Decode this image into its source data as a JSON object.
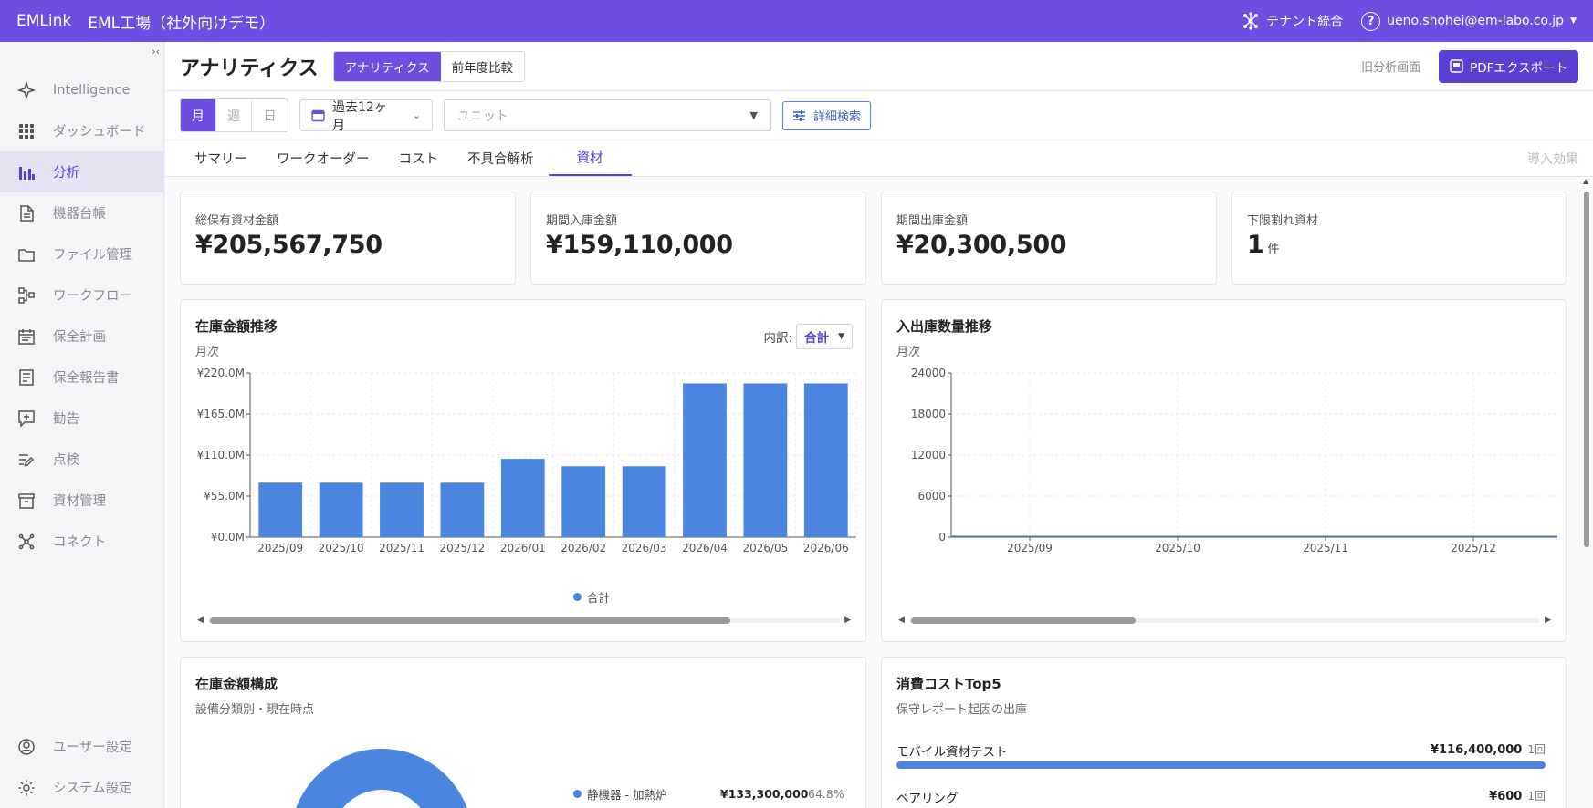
{
  "header": {
    "brand": "EMLink",
    "tenant": "EML工場（社外向けデモ）",
    "tenant_integration": "テナント統合",
    "user_email": "ueno.shohei@em-labo.co.jp"
  },
  "sidebar": {
    "collapse_glyph": "›‹",
    "items": [
      {
        "label": "Intelligence",
        "icon": "sparkle-icon"
      },
      {
        "label": "ダッシュボード",
        "icon": "grid-icon"
      },
      {
        "label": "分析",
        "icon": "bar-chart-icon",
        "active": true
      },
      {
        "label": "機器台帳",
        "icon": "document-icon"
      },
      {
        "label": "ファイル管理",
        "icon": "folder-icon"
      },
      {
        "label": "ワークフロー",
        "icon": "workflow-icon"
      },
      {
        "label": "保全計画",
        "icon": "calendar-icon"
      },
      {
        "label": "保全報告書",
        "icon": "report-icon"
      },
      {
        "label": "勧告",
        "icon": "advice-icon"
      },
      {
        "label": "点検",
        "icon": "inspection-icon"
      },
      {
        "label": "資材管理",
        "icon": "archive-icon"
      },
      {
        "label": "コネクト",
        "icon": "connect-icon"
      }
    ],
    "bottom_items": [
      {
        "label": "ユーザー設定",
        "icon": "user-icon"
      },
      {
        "label": "システム設定",
        "icon": "gear-icon"
      }
    ]
  },
  "page": {
    "title": "アナリティクス",
    "views": [
      "アナリティクス",
      "前年度比較"
    ],
    "old_analysis": "旧分析画面",
    "pdf_export": "PDFエクスポート"
  },
  "filters": {
    "periods": [
      "月",
      "週",
      "日"
    ],
    "range": "過去12ヶ月",
    "unit_placeholder": "ユニット",
    "detail_search": "詳細検索"
  },
  "tabs": {
    "items": [
      "サマリー",
      "ワークオーダー",
      "コスト",
      "不具合解析",
      "資材"
    ],
    "active": "資材",
    "right": "導入効果"
  },
  "kpis": [
    {
      "label": "総保有資材金額",
      "value": "¥205,567,750"
    },
    {
      "label": "期間入庫金額",
      "value": "¥159,110,000"
    },
    {
      "label": "期間出庫金額",
      "value": "¥20,300,500"
    },
    {
      "label": "下限割れ資材",
      "value": "1",
      "unit": "件"
    }
  ],
  "inventory_chart": {
    "title": "在庫金額推移",
    "subtitle": "月次",
    "breakdown_label": "内訳:",
    "breakdown_value": "合計"
  },
  "flow_chart": {
    "title": "入出庫数量推移",
    "subtitle": "月次"
  },
  "composition": {
    "title": "在庫金額構成",
    "subtitle": "設備分類別・現在時点",
    "legend": [
      {
        "label": "静機器 - 加熱炉",
        "value": "¥133,300,000",
        "pct": "64.8%"
      }
    ]
  },
  "top5": {
    "title": "消費コストTop5",
    "subtitle": "保守レポート起因の出庫",
    "items": [
      {
        "label": "モバイル資材テスト",
        "value": "¥116,400,000",
        "count": "1回",
        "ratio": 1.0
      },
      {
        "label": "ベアリング",
        "value": "¥600",
        "count": "1回",
        "ratio": 0.0
      }
    ]
  },
  "chart_data": [
    {
      "type": "bar",
      "title": "在庫金額推移",
      "categories": [
        "2025/09",
        "2025/10",
        "2025/11",
        "2025/12",
        "2026/01",
        "2026/02",
        "2026/03",
        "2026/04",
        "2026/05",
        "2026/06"
      ],
      "series": [
        {
          "name": "合計",
          "values": [
            73.0,
            73.0,
            73.0,
            73.0,
            105.0,
            95.0,
            95.0,
            206.0,
            206.0,
            206.0
          ]
        }
      ],
      "yticks": [
        "¥0.0M",
        "¥55.0M",
        "¥110.0M",
        "¥165.0M",
        "¥220.0M"
      ],
      "ylim": [
        0,
        220
      ],
      "grid": true,
      "legend": "bottom",
      "color": "#4a86e0"
    },
    {
      "type": "line",
      "title": "入出庫数量推移",
      "categories": [
        "2025/09",
        "2025/10",
        "2025/11",
        "2025/12"
      ],
      "yticks": [
        "0",
        "6000",
        "12000",
        "18000",
        "24000"
      ],
      "ylim": [
        0,
        24000
      ],
      "grid": true,
      "color": "#4a86e0"
    }
  ]
}
